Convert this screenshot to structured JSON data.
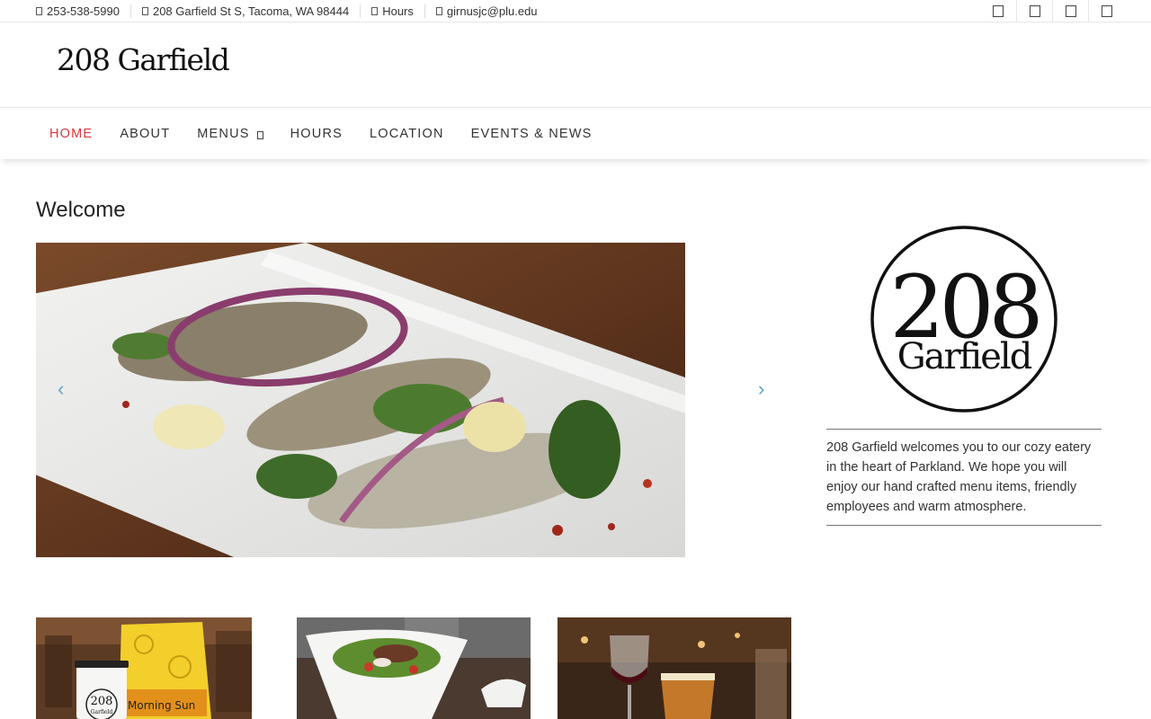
{
  "topbar": {
    "phone": "253-538-5990",
    "address": "208 Garfield St S, Tacoma, WA 98444",
    "hours": "Hours",
    "email": "girnusjc@plu.edu",
    "social_icons": [
      "facebook-icon",
      "twitter-icon",
      "instagram-icon",
      "yelp-icon"
    ]
  },
  "header": {
    "logo_text": "208 Garfield"
  },
  "nav": {
    "items": [
      {
        "label": "HOME",
        "active": true
      },
      {
        "label": "ABOUT",
        "active": false
      },
      {
        "label": "MENUS",
        "active": false,
        "has_dropdown": true
      },
      {
        "label": "HOURS",
        "active": false
      },
      {
        "label": "LOCATION",
        "active": false
      },
      {
        "label": "EVENTS & NEWS",
        "active": false
      }
    ]
  },
  "main": {
    "title": "Welcome",
    "slider": {
      "prev": "‹",
      "next": "›"
    }
  },
  "sidebar": {
    "badge_number": "208",
    "badge_name": "Garfield",
    "about": "208 Garfield welcomes you to our cozy eatery in the heart of Parkland. We hope you will enjoy our hand crafted menu items, friendly employees and warm atmosphere."
  },
  "thumbs": {
    "coffee_cup_text": "208",
    "coffee_cup_subtext": "Garfield",
    "coffee_bag_label": "Morning Sun"
  },
  "colors": {
    "accent_active_nav": "#d9363e",
    "slider_arrow": "#5aa6d6"
  }
}
